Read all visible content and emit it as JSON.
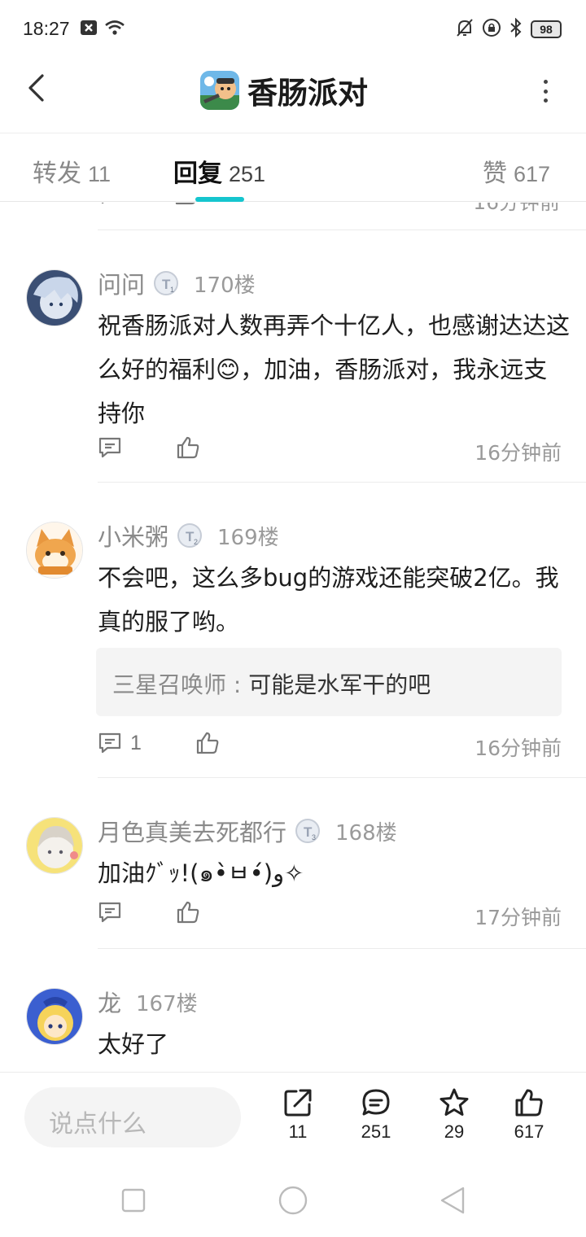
{
  "status": {
    "time": "18:27",
    "battery": "98"
  },
  "header": {
    "title": "香肠派对"
  },
  "tabs": [
    {
      "label": "转发",
      "count": "11"
    },
    {
      "label": "回复",
      "count": "251"
    },
    {
      "label": "赞",
      "count": "617"
    }
  ],
  "partial": {
    "time": "16分钟前"
  },
  "comments": [
    {
      "username": "问问",
      "level_badge": "T1",
      "floor": "170楼",
      "text": "祝香肠派对人数再弄个十亿人，也感谢达达这么好的福利😊，加油，香肠派对，我永远支持你",
      "reply_count": "",
      "time": "16分钟前"
    },
    {
      "username": "小米粥",
      "level_badge": "T2",
      "floor": "169楼",
      "text": "不会吧，这么多bug的游戏还能突破2亿。我真的服了哟。",
      "reply": {
        "name": "三星召唤师",
        "separator": " : ",
        "text": "可能是水军干的吧"
      },
      "reply_count": "1",
      "time": "16分钟前"
    },
    {
      "username": "月色真美去死都行",
      "level_badge": "T3",
      "floor": "168楼",
      "text": "加油ｸﾞｯ!(๑•̀ㅂ•́)و✧",
      "reply_count": "",
      "time": "17分钟前"
    },
    {
      "username": "龙",
      "level_badge": "",
      "floor": "167楼",
      "text": "太好了"
    }
  ],
  "bottom": {
    "placeholder": "说点什么",
    "share_count": "11",
    "comment_count": "251",
    "favorite_count": "29",
    "like_count": "617"
  },
  "icons": {
    "accent": "#15c5ce",
    "back": "chevron-left-icon",
    "more": "more-vertical-icon",
    "comment": "comment-icon",
    "like": "thumbs-up-icon",
    "share": "share-icon",
    "favorite": "star-icon"
  }
}
